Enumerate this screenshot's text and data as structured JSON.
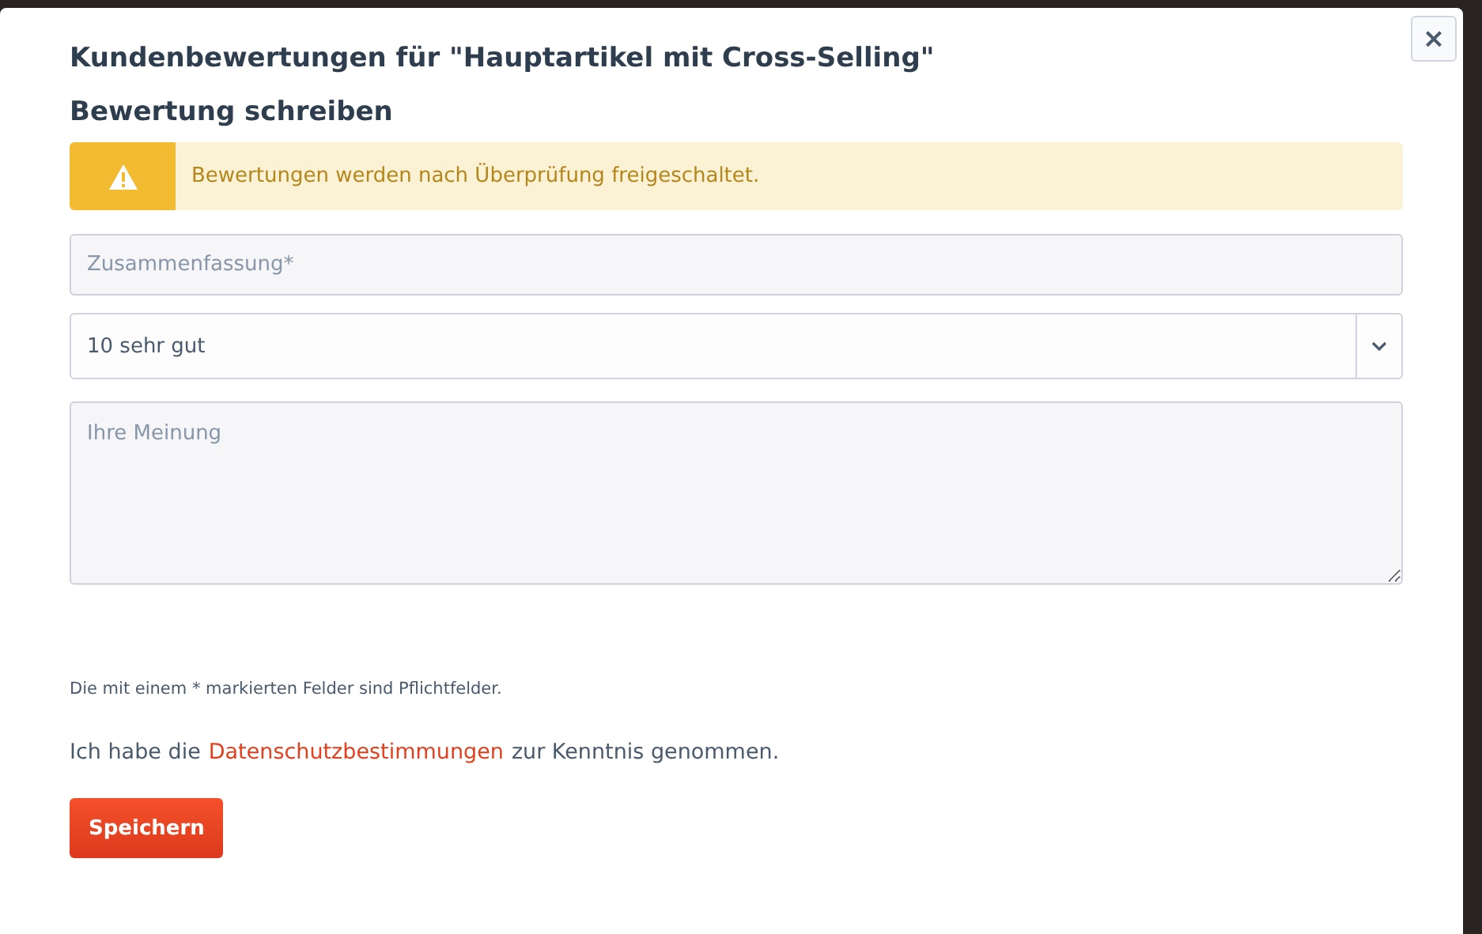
{
  "modal": {
    "close": "×",
    "title": "Kundenbewertungen für \"Hauptartikel mit Cross-Selling\"",
    "subtitle": "Bewertung schreiben"
  },
  "alert": {
    "text": "Bewertungen werden nach Überprüfung freigeschaltet."
  },
  "form": {
    "summary": {
      "placeholder": "Zusammenfassung*"
    },
    "rating": {
      "value": "10 sehr gut"
    },
    "opinion": {
      "placeholder": "Ihre Meinung"
    }
  },
  "required_note": "Die mit einem * markierten Felder sind Pflichtfelder.",
  "privacy": {
    "before": "Ich habe die",
    "link": "Datenschutzbestimmungen",
    "after": "zur Kenntnis genommen."
  },
  "buttons": [
    "Speichern"
  ]
}
